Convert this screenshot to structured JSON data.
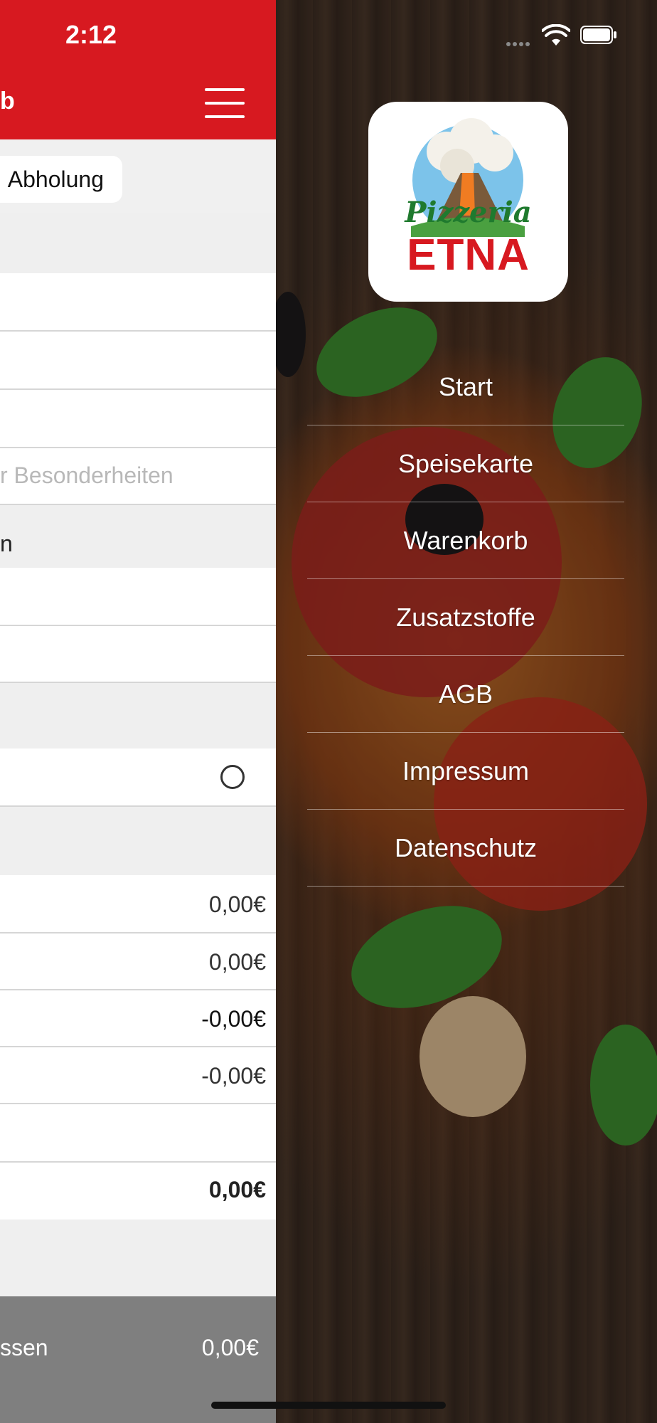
{
  "status_bar": {
    "time": "2:12"
  },
  "header": {
    "title": "b"
  },
  "order_type": {
    "label": "Abholung"
  },
  "form": {
    "notes_placeholder": "r Besonderheiten",
    "section_text": "n"
  },
  "prices": {
    "row1": "0,00€",
    "row2": "0,00€",
    "row3": "-0,00€",
    "row4": "-0,00€",
    "total": "0,00€"
  },
  "footer": {
    "label": "ssen",
    "price": "0,00€"
  },
  "logo": {
    "line1": "Pizzeria",
    "line2": "ETNA"
  },
  "menu": {
    "items": [
      {
        "label": "Start"
      },
      {
        "label": "Speisekarte"
      },
      {
        "label": "Warenkorb"
      },
      {
        "label": "Zusatzstoffe"
      },
      {
        "label": "AGB"
      },
      {
        "label": "Impressum"
      },
      {
        "label": "Datenschutz"
      }
    ]
  },
  "colors": {
    "brand_red": "#d71920",
    "footer_gray": "#7f7f7f"
  }
}
